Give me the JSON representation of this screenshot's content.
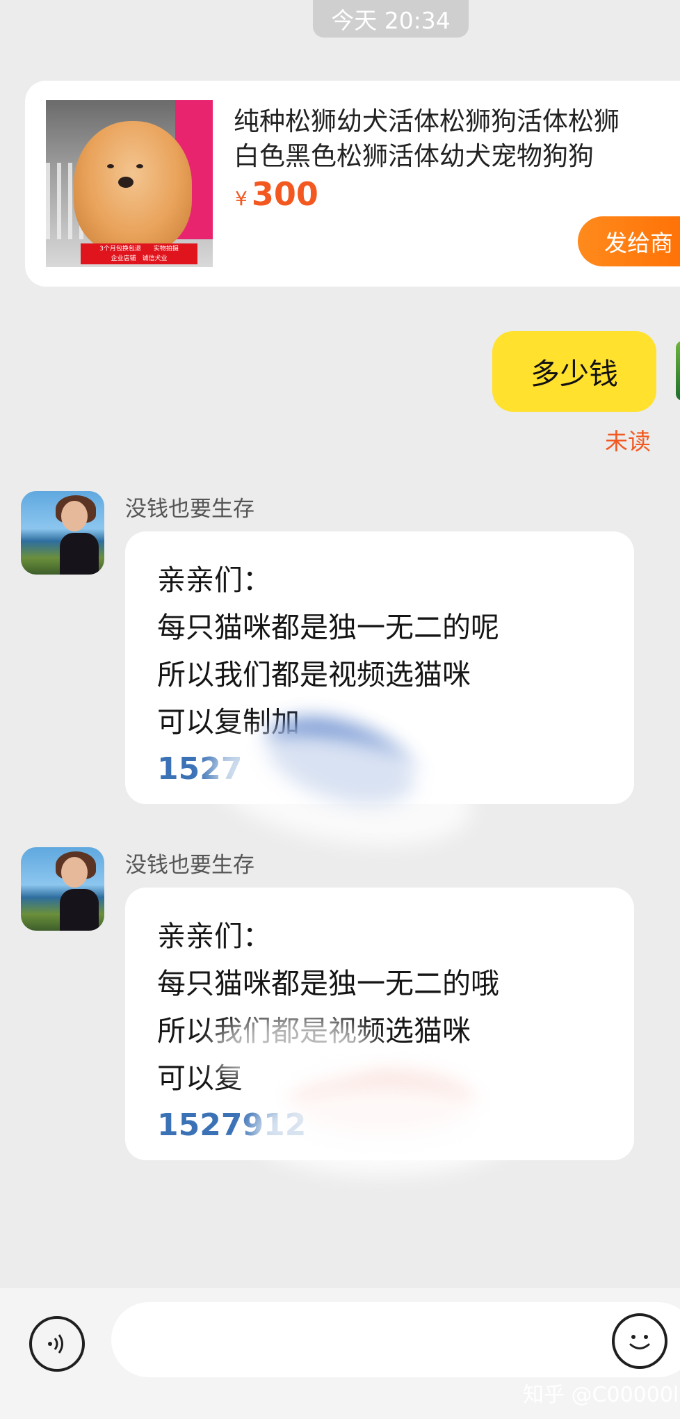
{
  "timestamp": "今天 20:34",
  "product": {
    "title_line1": "纯种松狮幼犬活体松狮狗活体松狮",
    "title_line2": "白色黑色松狮活体幼犬宠物狗狗",
    "currency": "¥",
    "price": "300",
    "photo_banner_line1": "3个月包换包退　　实物拍摄",
    "photo_banner_line2": "企业店铺　诚信犬业",
    "send_button": "发给商"
  },
  "my_message": {
    "text": "多少钱",
    "status": "未读"
  },
  "messages": [
    {
      "sender": "没钱也要生存",
      "line1": "亲亲们：",
      "line2": "每只猫咪都是独一无二的呢",
      "line3": "所以我们都是视频选猫咪",
      "line4": "可以复制加",
      "phone": "1527"
    },
    {
      "sender": "没钱也要生存",
      "line1": "亲亲们：",
      "line2": "每只猫咪都是独一无二的哦",
      "line3": "所以我们都是视频选猫咪",
      "line4": "可以复",
      "phone": "1527912"
    }
  ],
  "input_bar": {
    "voice_icon": "voice-icon",
    "emoji_icon": "smiley-icon"
  },
  "watermark": "知乎 @C00000l"
}
